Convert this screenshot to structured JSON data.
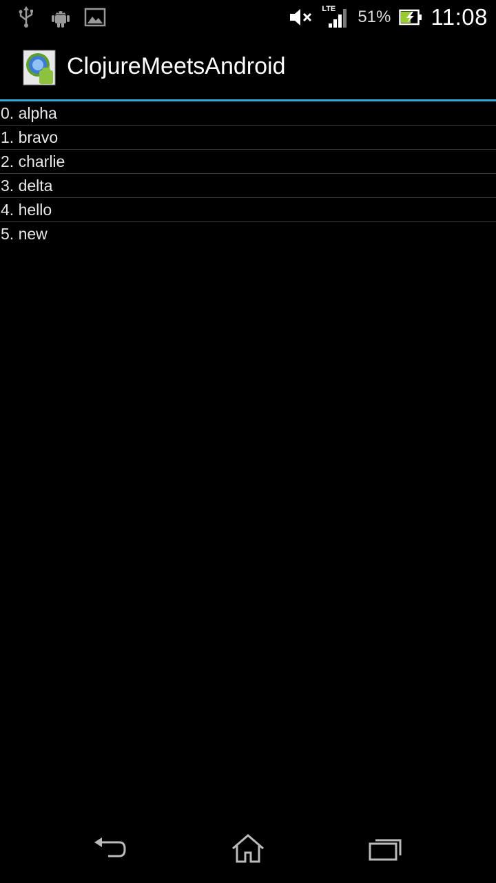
{
  "status_bar": {
    "left_icons": [
      "usb-icon",
      "android-debug-icon",
      "image-notification-icon"
    ],
    "right_icons": [
      "volume-muted-icon",
      "lte-signal-icon",
      "battery-charging-icon"
    ],
    "network_label": "LTE",
    "battery_percent": "51%",
    "time": "11:08"
  },
  "action_bar": {
    "app_icon": "clojure-android-app-icon",
    "title": "ClojureMeetsAndroid",
    "accent_color": "#33a9d8"
  },
  "list": {
    "items": [
      {
        "label": "0. alpha"
      },
      {
        "label": "1. bravo"
      },
      {
        "label": "2. charlie"
      },
      {
        "label": "3. delta"
      },
      {
        "label": "4. hello"
      },
      {
        "label": "5. new"
      }
    ]
  },
  "nav_bar": {
    "buttons": [
      "back-icon",
      "home-icon",
      "recent-apps-icon"
    ]
  }
}
